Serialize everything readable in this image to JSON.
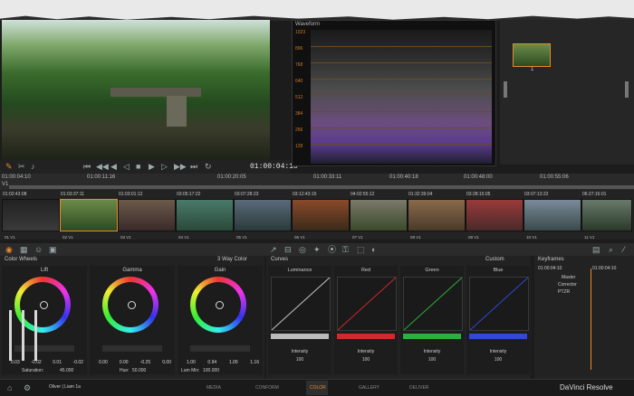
{
  "viewer": {
    "timecode": "01:00:04:10"
  },
  "ruler": {
    "marks": [
      "01:00:04:10",
      "01:00:11:16",
      "01:00:20:05",
      "01:00:33:11",
      "01:00:40:18",
      "01:00:48:00",
      "01:00:55:06"
    ],
    "track": "V1"
  },
  "clips": [
    {
      "tc": "01:02:43:08",
      "name": "01 V1"
    },
    {
      "tc": "01:03:37:11",
      "name": "02 V1"
    },
    {
      "tc": "01:03:01:12",
      "name": "03 V1"
    },
    {
      "tc": "03:05:17:22",
      "name": "04 V1"
    },
    {
      "tc": "03:07:28:23",
      "name": "05 V1"
    },
    {
      "tc": "03:12:43:15",
      "name": "06 V1"
    },
    {
      "tc": "04:02:55:12",
      "name": "07 V1"
    },
    {
      "tc": "01:32:39:04",
      "name": "08 V1"
    },
    {
      "tc": "03:28:15:05",
      "name": "09 V1"
    },
    {
      "tc": "03:07:13:22",
      "name": "10 V1"
    },
    {
      "tc": "06:27:16:01",
      "name": "11 V1"
    }
  ],
  "scope": {
    "title": "Waveform",
    "ylabels": [
      "1023",
      "896",
      "768",
      "640",
      "512",
      "384",
      "256",
      "128"
    ]
  },
  "nodes": {
    "label": "1"
  },
  "color_wheels": {
    "title": "Color Wheels",
    "mode": "3 Way Color",
    "wheels": [
      {
        "label": "Lift",
        "vals": [
          "0.03",
          "-0.02",
          "0.01",
          "-0.02"
        ]
      },
      {
        "label": "Gamma",
        "vals": [
          "0.00",
          "0.00",
          "-0.25",
          "0.00"
        ]
      },
      {
        "label": "Gain",
        "vals": [
          "1.00",
          "0.94",
          "1.00",
          "1.16"
        ]
      }
    ],
    "saturation_label": "Saturation:",
    "saturation": "45.000",
    "hue_label": "Hue:",
    "hue": "50.000",
    "lummix_label": "Lum Mix:",
    "lummix": "100.000"
  },
  "curves": {
    "title": "Curves",
    "mode": "Custom",
    "channels": [
      {
        "label": "Luminance",
        "color": "#bbbbbb",
        "intensity_label": "Intensity",
        "intensity": "100"
      },
      {
        "label": "Red",
        "color": "#d22a2a",
        "intensity_label": "Intensity",
        "intensity": "100"
      },
      {
        "label": "Green",
        "color": "#2fae3b",
        "intensity_label": "Intensity",
        "intensity": "100"
      },
      {
        "label": "Blue",
        "color": "#2f4bd6",
        "intensity_label": "Intensity",
        "intensity": "100"
      }
    ]
  },
  "keyframes": {
    "title": "Keyframes",
    "tc1": "01:00:04:10",
    "tc2": "01:00:04:10",
    "rows": [
      "Master",
      "Corrector",
      "PTZR"
    ]
  },
  "bottom": {
    "user": "Oliver | Liam 1a",
    "tabs": [
      "MEDIA",
      "CONFORM",
      "COLOR",
      "GALLERY",
      "DELIVER"
    ],
    "brand": "DaVinci Resolve"
  },
  "colors": {
    "accent": "#e78a2b"
  }
}
